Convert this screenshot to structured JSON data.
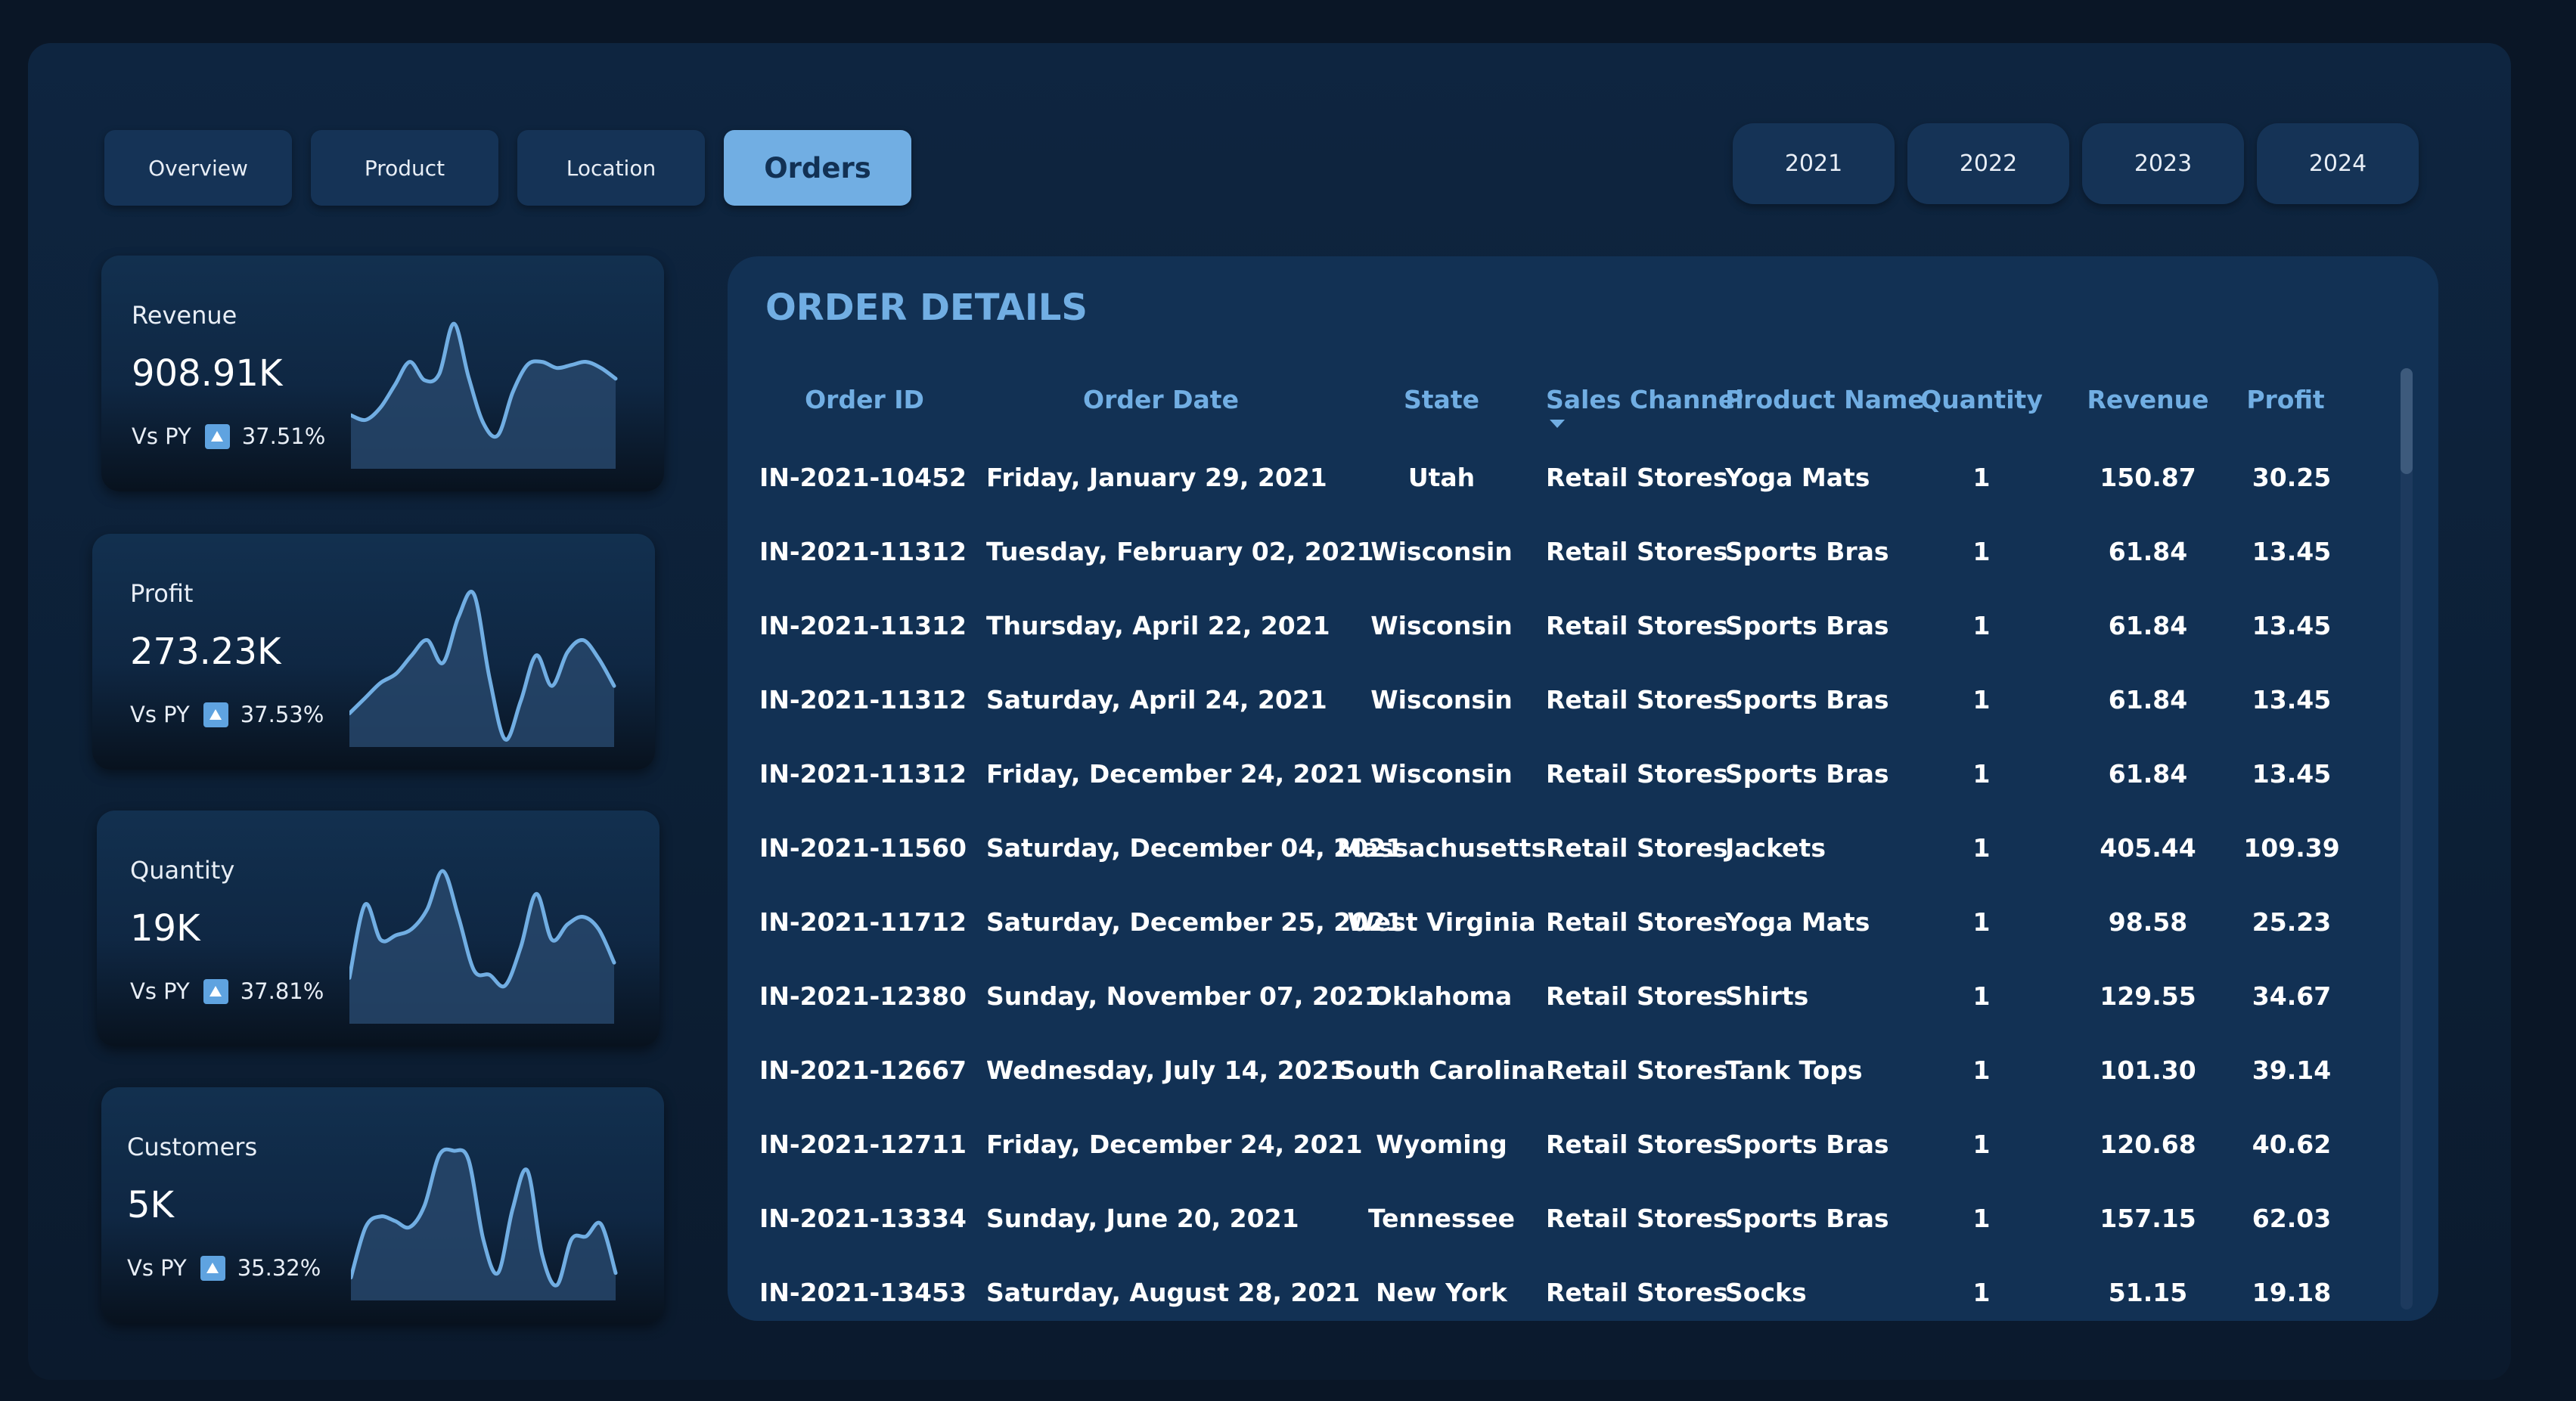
{
  "tabs": [
    {
      "label": "Overview",
      "active": false
    },
    {
      "label": "Product",
      "active": false
    },
    {
      "label": "Location",
      "active": false
    },
    {
      "label": "Orders",
      "active": true
    }
  ],
  "years": [
    "2021",
    "2022",
    "2023",
    "2024"
  ],
  "kpis": [
    {
      "title": "Revenue",
      "value": "908.91K",
      "vs_label": "Vs PY",
      "change": "37.51%",
      "trend": [
        0.35,
        0.32,
        0.4,
        0.55,
        0.7,
        0.58,
        0.62,
        0.95,
        0.6,
        0.3,
        0.22,
        0.5,
        0.68,
        0.7,
        0.66,
        0.68,
        0.7,
        0.66,
        0.59
      ]
    },
    {
      "title": "Profit",
      "value": "273.23K",
      "vs_label": "Vs PY",
      "change": "37.53%",
      "trend": [
        0.22,
        0.32,
        0.42,
        0.48,
        0.6,
        0.7,
        0.55,
        0.85,
        1.0,
        0.45,
        0.05,
        0.3,
        0.6,
        0.4,
        0.62,
        0.7,
        0.58,
        0.4
      ]
    },
    {
      "title": "Quantity",
      "value": "19K",
      "vs_label": "Vs PY",
      "change": "37.81%",
      "trend": [
        0.3,
        0.78,
        0.55,
        0.58,
        0.62,
        0.75,
        1.0,
        0.7,
        0.35,
        0.32,
        0.25,
        0.5,
        0.85,
        0.55,
        0.65,
        0.7,
        0.62,
        0.4
      ]
    },
    {
      "title": "Customers",
      "value": "5K",
      "vs_label": "Vs PY",
      "change": "35.32%",
      "trend": [
        0.15,
        0.48,
        0.55,
        0.52,
        0.48,
        0.62,
        0.95,
        0.98,
        0.92,
        0.4,
        0.18,
        0.6,
        0.85,
        0.3,
        0.1,
        0.4,
        0.42,
        0.5,
        0.18
      ]
    }
  ],
  "orders": {
    "title": "ORDER DETAILS",
    "columns": [
      "Order ID",
      "Order Date",
      "State",
      "Sales Channel",
      "Product Name",
      "Quantity",
      "Revenue",
      "Profit"
    ],
    "rows": [
      [
        "IN-2021-10452",
        "Friday, January 29, 2021",
        "Utah",
        "Retail Stores",
        "Yoga Mats",
        "1",
        "150.87",
        "30.25"
      ],
      [
        "IN-2021-11312",
        "Tuesday, February 02, 2021",
        "Wisconsin",
        "Retail Stores",
        "Sports Bras",
        "1",
        "61.84",
        "13.45"
      ],
      [
        "IN-2021-11312",
        "Thursday, April 22, 2021",
        "Wisconsin",
        "Retail Stores",
        "Sports Bras",
        "1",
        "61.84",
        "13.45"
      ],
      [
        "IN-2021-11312",
        "Saturday, April 24, 2021",
        "Wisconsin",
        "Retail Stores",
        "Sports Bras",
        "1",
        "61.84",
        "13.45"
      ],
      [
        "IN-2021-11312",
        "Friday, December 24, 2021",
        "Wisconsin",
        "Retail Stores",
        "Sports Bras",
        "1",
        "61.84",
        "13.45"
      ],
      [
        "IN-2021-11560",
        "Saturday, December 04, 2021",
        "Massachusetts",
        "Retail Stores",
        "Jackets",
        "1",
        "405.44",
        "109.39"
      ],
      [
        "IN-2021-11712",
        "Saturday, December 25, 2021",
        "West Virginia",
        "Retail Stores",
        "Yoga Mats",
        "1",
        "98.58",
        "25.23"
      ],
      [
        "IN-2021-12380",
        "Sunday, November 07, 2021",
        "Oklahoma",
        "Retail Stores",
        "Shirts",
        "1",
        "129.55",
        "34.67"
      ],
      [
        "IN-2021-12667",
        "Wednesday, July 14, 2021",
        "South Carolina",
        "Retail Stores",
        "Tank Tops",
        "1",
        "101.30",
        "39.14"
      ],
      [
        "IN-2021-12711",
        "Friday, December 24, 2021",
        "Wyoming",
        "Retail Stores",
        "Sports Bras",
        "1",
        "120.68",
        "40.62"
      ],
      [
        "IN-2021-13334",
        "Sunday, June 20, 2021",
        "Tennessee",
        "Retail Stores",
        "Sports Bras",
        "1",
        "157.15",
        "62.03"
      ],
      [
        "IN-2021-13453",
        "Saturday, August 28, 2021",
        "New York",
        "Retail Stores",
        "Socks",
        "1",
        "51.15",
        "19.18"
      ]
    ]
  },
  "colors": {
    "accent": "#71aee3",
    "background": "#0a1626",
    "card": "#123154"
  }
}
